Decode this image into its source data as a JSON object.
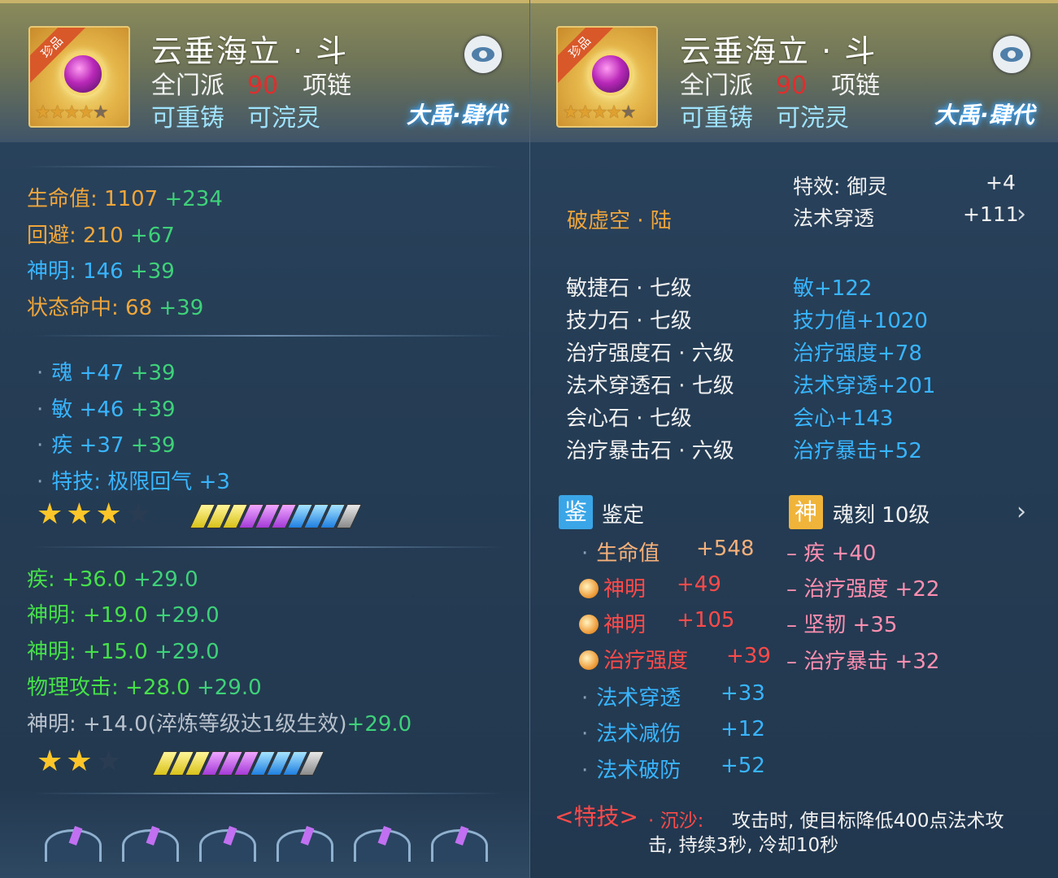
{
  "item": {
    "badge": "珍品",
    "name": "云垂海立 · 斗",
    "sect": "全门派",
    "level": "90",
    "type": "项链",
    "recast": "可重铸",
    "soul": "可浣灵",
    "brand": "大禹·肆代",
    "star_rating": "4 of 5"
  },
  "left": {
    "base_stats": [
      {
        "label": "生命值:",
        "value": "1107",
        "bonus": "+234",
        "color": "orange"
      },
      {
        "label": "回避:",
        "value": "210",
        "bonus": "+67",
        "color": "orange"
      },
      {
        "label": "神明:",
        "value": "146",
        "bonus": "+39",
        "color": "blue"
      },
      {
        "label": "状态命中:",
        "value": "68",
        "bonus": "+39",
        "color": "orange"
      }
    ],
    "attr_stats": [
      {
        "label": "魂",
        "value": "+47",
        "bonus": "+39"
      },
      {
        "label": "敏",
        "value": "+46",
        "bonus": "+39"
      },
      {
        "label": "疾",
        "value": "+37",
        "bonus": "+39"
      }
    ],
    "skill": {
      "label": "特技:",
      "name": "极限回气",
      "value": "+3"
    },
    "rating1": {
      "stars": 3,
      "max": 4
    },
    "refine": [
      {
        "label": "疾:",
        "value": "+36.0",
        "bonus": "+29.0"
      },
      {
        "label": "神明:",
        "value": "+19.0",
        "bonus": "+29.0"
      },
      {
        "label": "神明:",
        "value": "+15.0",
        "bonus": "+29.0"
      },
      {
        "label": "物理攻击:",
        "value": "+28.0",
        "bonus": "+29.0"
      }
    ],
    "refine_inactive": {
      "text": "神明: +14.0(淬炼等级达1级生效)",
      "bonus": "+29.0"
    },
    "rating2": {
      "stars": 2,
      "max": 3
    }
  },
  "right": {
    "effect": {
      "label": "特效:",
      "name": "御灵",
      "value": "+4"
    },
    "penetration": {
      "label": "法术穿透",
      "value": "+111"
    },
    "set_name": "破虚空 · 陆",
    "gems": [
      {
        "name": "敏捷石 · 七级",
        "effect": "敏+122"
      },
      {
        "name": "技力石 · 七级",
        "effect": "技力值+1020"
      },
      {
        "name": "治疗强度石 · 六级",
        "effect": "治疗强度+78"
      },
      {
        "name": "法术穿透石 · 七级",
        "effect": "法术穿透+201"
      },
      {
        "name": "会心石 · 七级",
        "effect": "会心+143"
      },
      {
        "name": "治疗暴击石 · 六级",
        "effect": "治疗暴击+52"
      }
    ],
    "appraise": {
      "badge": "鉴",
      "title": "鉴定",
      "items": [
        {
          "kind": "dot",
          "label": "生命值",
          "value": "+548",
          "color": "peach"
        },
        {
          "kind": "coin",
          "label": "神明",
          "value": "+49",
          "color": "red"
        },
        {
          "kind": "coin",
          "label": "神明",
          "value": "+105",
          "color": "red"
        },
        {
          "kind": "coin",
          "label": "治疗强度",
          "value": "+39",
          "color": "red"
        },
        {
          "kind": "dot",
          "label": "法术穿透",
          "value": "+33",
          "color": "blue"
        },
        {
          "kind": "dot",
          "label": "法术减伤",
          "value": "+12",
          "color": "blue"
        },
        {
          "kind": "dot",
          "label": "法术破防",
          "value": "+52",
          "color": "blue"
        }
      ]
    },
    "engrave": {
      "badge": "神",
      "title": "魂刻",
      "level": "10级",
      "items": [
        {
          "label": "疾",
          "value": "+40"
        },
        {
          "label": "治疗强度",
          "value": "+22"
        },
        {
          "label": "坚韧",
          "value": "+35"
        },
        {
          "label": "治疗暴击",
          "value": "+32"
        }
      ]
    },
    "special": {
      "tag": "<特技>",
      "name": "· 沉沙:",
      "desc1": "攻击时, 使目标降低400点法术攻",
      "desc2": "击, 持续3秒, 冷却10秒"
    }
  },
  "colors": {
    "orange": "#f0a63b",
    "green": "#3fd17a",
    "blue": "#39b5ff",
    "pink": "#ff8fb0",
    "red": "#ff4a4a"
  }
}
